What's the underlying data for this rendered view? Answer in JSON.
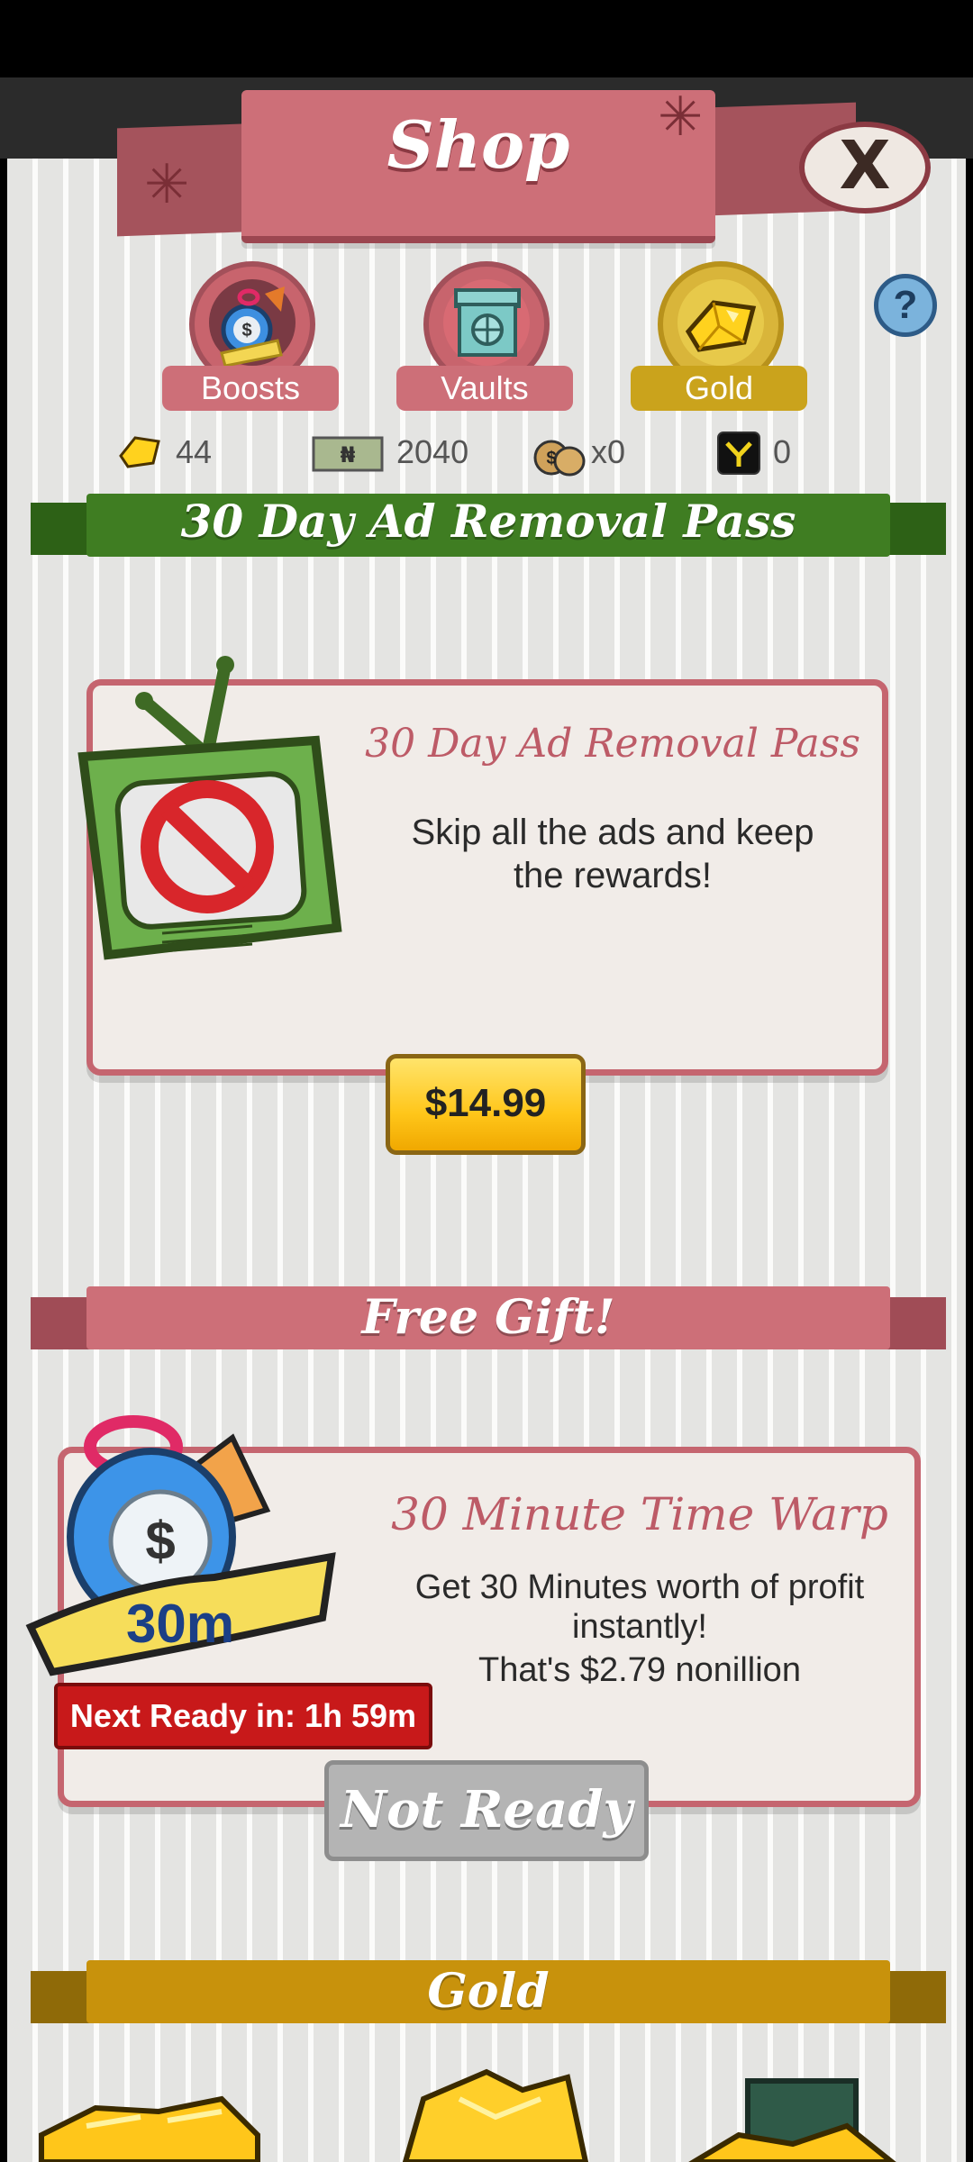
{
  "header": {
    "title": "Shop",
    "close_label": "X"
  },
  "tabs": [
    {
      "label": "Boosts",
      "icon": "stopwatch-money-bag-icon"
    },
    {
      "label": "Vaults",
      "icon": "vault-icon"
    },
    {
      "label": "Gold",
      "icon": "gold-bar-icon"
    }
  ],
  "help_label": "?",
  "currencies": [
    {
      "icon": "gold-icon",
      "value": "44"
    },
    {
      "icon": "cash-icon",
      "value": "2040"
    },
    {
      "icon": "money-bags-icon",
      "value": "x0"
    },
    {
      "icon": "mega-bucks-icon",
      "value": "0"
    }
  ],
  "sections": {
    "ad_pass": {
      "banner": "30 Day Ad Removal Pass",
      "card_title": "30 Day Ad Removal Pass",
      "description": "Skip all the ads and keep the rewards!",
      "price": "$14.99",
      "icon": "no-ads-tv-icon"
    },
    "free_gift": {
      "banner": "Free Gift!",
      "card_title": "30 Minute Time Warp",
      "description_line1": "Get 30 Minutes worth of profit instantly!",
      "description_line2": "That's $2.79 nonillion",
      "badge": "30m",
      "next_ready": "Next Ready in: 1h 59m",
      "button": "Not Ready",
      "icon": "time-warp-stopwatch-icon"
    },
    "gold": {
      "banner": "Gold"
    }
  },
  "colors": {
    "red_banner": "#cd6f78",
    "green_banner": "#3f7d22",
    "gold_banner": "#c8920c",
    "price_button": "#ffc61a"
  }
}
